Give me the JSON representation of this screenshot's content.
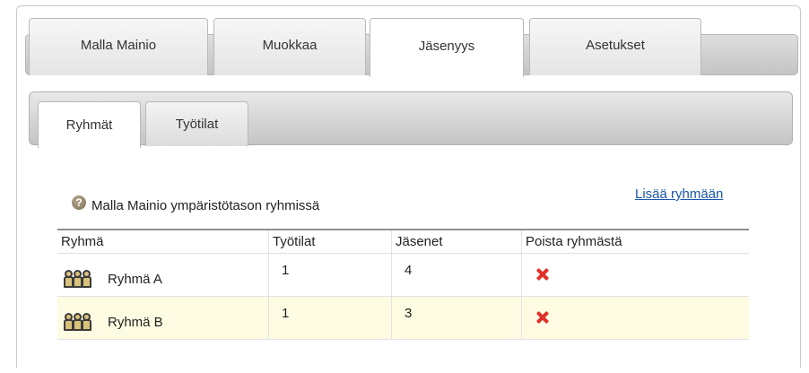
{
  "main_tabs": [
    {
      "label": "Malla Mainio",
      "active": false
    },
    {
      "label": "Muokkaa",
      "active": false
    },
    {
      "label": "Jäsenyys",
      "active": true
    },
    {
      "label": "Asetukset",
      "active": false
    }
  ],
  "sub_tabs": [
    {
      "label": "Ryhmät",
      "active": true
    },
    {
      "label": "Työtilat",
      "active": false
    }
  ],
  "section": {
    "help_icon": "question-circle-icon",
    "title": "Malla Mainio ympäristötason ryhmissä",
    "add_link": "Lisää ryhmään"
  },
  "table": {
    "headers": [
      "Ryhmä",
      "Työtilat",
      "Jäsenet",
      "Poista ryhmästä"
    ],
    "rows": [
      {
        "name": "Ryhmä A",
        "workspaces": "1",
        "members": "4",
        "icon": "group-icon",
        "remove_icon": "delete-x-icon"
      },
      {
        "name": "Ryhmä B",
        "workspaces": "1",
        "members": "3",
        "icon": "group-icon",
        "remove_icon": "delete-x-icon"
      }
    ]
  },
  "colors": {
    "link": "#1a58a8",
    "delete": "#e0312a",
    "highlight_row": "#fdfbe1"
  }
}
